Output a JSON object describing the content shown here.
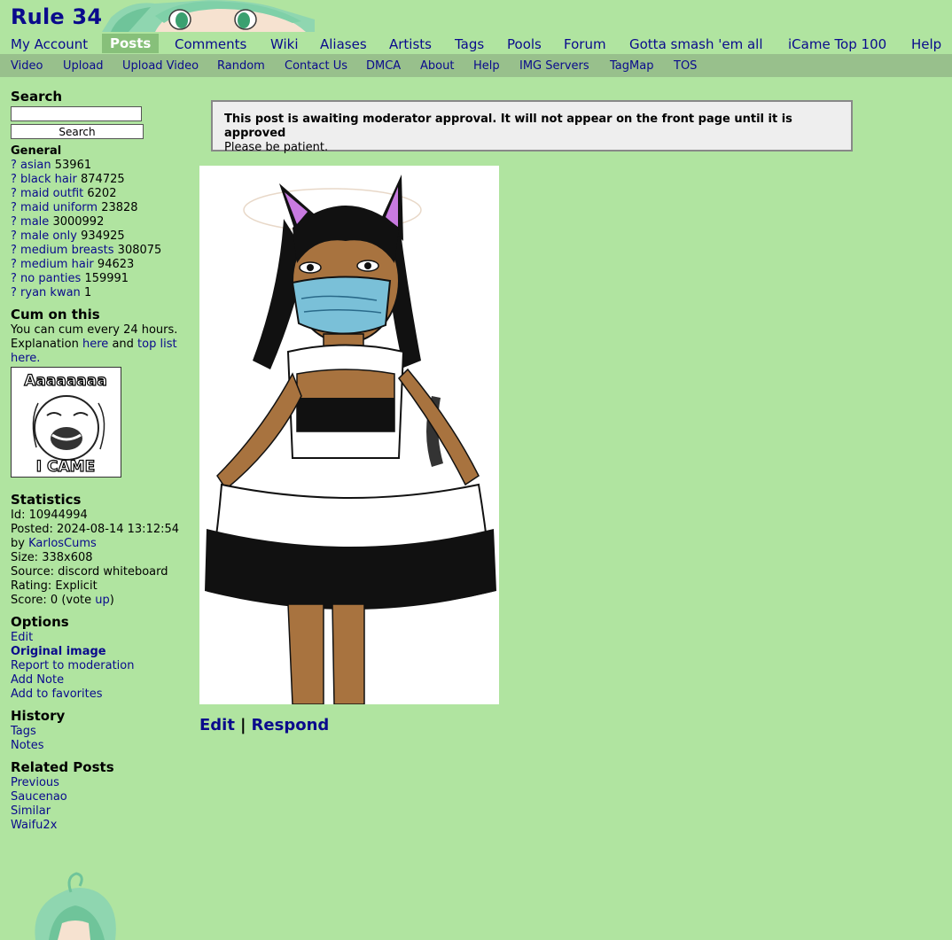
{
  "site": {
    "title": "Rule 34"
  },
  "nav": {
    "items": [
      "My Account",
      "Posts",
      "Comments",
      "Wiki",
      "Aliases",
      "Artists",
      "Tags",
      "Pools",
      "Forum",
      "Gotta smash 'em all",
      "iCame Top 100",
      "Help"
    ],
    "current": "Posts"
  },
  "subnav": {
    "items": [
      "Video",
      "Upload",
      "Upload Video",
      "Random",
      "Contact Us",
      "DMCA",
      "About",
      "Help",
      "IMG Servers",
      "TagMap",
      "TOS"
    ]
  },
  "search": {
    "title": "Search",
    "value": "",
    "button_label": "Search"
  },
  "tags": {
    "section_title": "General",
    "help_glyph": "?",
    "items": [
      {
        "name": "asian",
        "count": "53961"
      },
      {
        "name": "black hair",
        "count": "874725"
      },
      {
        "name": "maid outfit",
        "count": "6202"
      },
      {
        "name": "maid uniform",
        "count": "23828"
      },
      {
        "name": "male",
        "count": "3000992"
      },
      {
        "name": "male only",
        "count": "934925"
      },
      {
        "name": "medium breasts",
        "count": "308075"
      },
      {
        "name": "medium hair",
        "count": "94623"
      },
      {
        "name": "no panties",
        "count": "159991"
      },
      {
        "name": "ryan kwan",
        "count": "1"
      }
    ]
  },
  "cum": {
    "title": "Cum on this",
    "line1": "You can cum every 24 hours.",
    "explanation_prefix": "Explanation",
    "here_link": "here",
    "and_text": "and",
    "top_list_link": "top list",
    "here2_link": "here.",
    "image_text_top": "Aaaaaaaa",
    "image_text_bottom": "I CAME"
  },
  "stats": {
    "title": "Statistics",
    "id": "Id: 10944994",
    "posted": "Posted: 2024-08-14 13:12:54",
    "by_label": "by",
    "author": "KarlosCums",
    "size": "Size: 338x608",
    "source": "Source: discord whiteboard",
    "rating": "Rating: Explicit",
    "score_prefix": "Score: 0 (vote",
    "vote_up": "up",
    "score_suffix": ")"
  },
  "options": {
    "title": "Options",
    "items": [
      "Edit",
      "Original image",
      "Report to moderation",
      "Add Note",
      "Add to favorites"
    ]
  },
  "history": {
    "title": "History",
    "items": [
      "Tags",
      "Notes"
    ]
  },
  "related": {
    "title": "Related Posts",
    "items": [
      "Previous",
      "Saucenao",
      "Similar",
      "Waifu2x"
    ]
  },
  "notice": {
    "title": "This post is awaiting moderator approval. It will not appear on the front page until it is approved",
    "subtitle": "Please be patient."
  },
  "post_actions": {
    "edit": "Edit",
    "separator": "|",
    "respond": "Respond"
  },
  "colors": {
    "background": "#b0e4a0",
    "subnav": "#98c08c",
    "link": "#0a0a8c",
    "nav_current": "#87c07a"
  }
}
